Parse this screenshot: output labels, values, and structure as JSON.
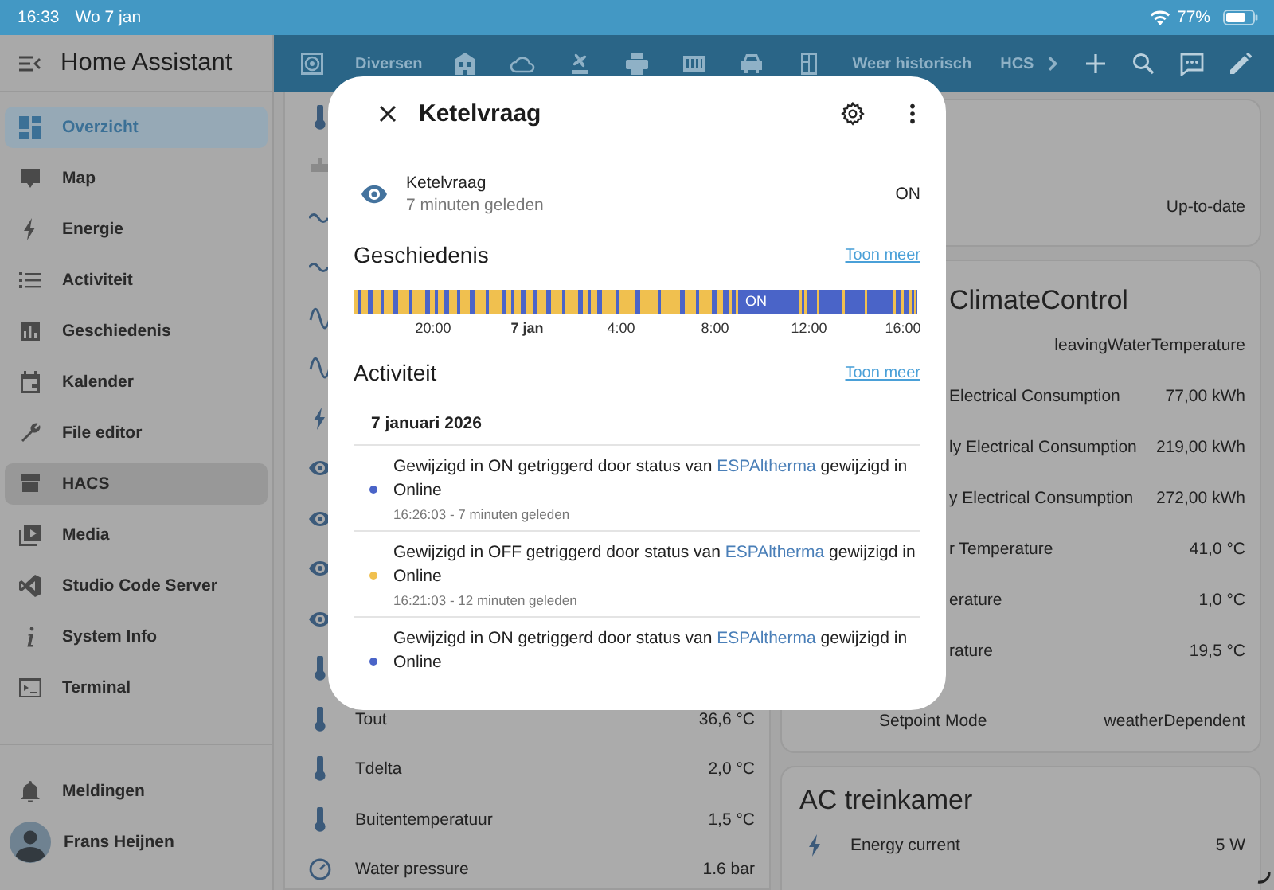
{
  "status_bar": {
    "time": "16:33",
    "date": "Wo 7 jan",
    "battery": "77%"
  },
  "sidebar": {
    "title": "Home Assistant",
    "items": [
      {
        "label": "Overzicht",
        "selected": true,
        "hovered": false
      },
      {
        "label": "Map",
        "selected": false,
        "hovered": false
      },
      {
        "label": "Energie",
        "selected": false,
        "hovered": false
      },
      {
        "label": "Activiteit",
        "selected": false,
        "hovered": false
      },
      {
        "label": "Geschiedenis",
        "selected": false,
        "hovered": false
      },
      {
        "label": "Kalender",
        "selected": false,
        "hovered": false
      },
      {
        "label": "File editor",
        "selected": false,
        "hovered": false
      },
      {
        "label": "HACS",
        "selected": false,
        "hovered": true
      },
      {
        "label": "Media",
        "selected": false,
        "hovered": false
      },
      {
        "label": "Studio Code Server",
        "selected": false,
        "hovered": false
      },
      {
        "label": "System Info",
        "selected": false,
        "hovered": false
      },
      {
        "label": "Terminal",
        "selected": false,
        "hovered": false
      }
    ],
    "notifications": "Meldingen",
    "user": "Frans Heijnen"
  },
  "toolbar": {
    "tabs": [
      {
        "kind": "icon"
      },
      {
        "kind": "text",
        "label": "Diversen"
      },
      {
        "kind": "icon"
      },
      {
        "kind": "icon"
      },
      {
        "kind": "icon"
      },
      {
        "kind": "icon"
      },
      {
        "kind": "icon"
      },
      {
        "kind": "icon"
      },
      {
        "kind": "icon"
      },
      {
        "kind": "text",
        "label": "Weer historisch"
      },
      {
        "kind": "text",
        "label": "HCS"
      }
    ]
  },
  "left_card": {
    "rows": [
      {
        "kind": "thermometer"
      },
      {
        "kind": "meter"
      },
      {
        "kind": "wave"
      },
      {
        "kind": "wave"
      },
      {
        "kind": "sine"
      },
      {
        "kind": "sine"
      },
      {
        "kind": "bolt"
      },
      {
        "kind": "eye"
      },
      {
        "kind": "eye"
      },
      {
        "kind": "eye"
      },
      {
        "kind": "eye"
      },
      {
        "kind": "thermometer"
      },
      {
        "kind": "thermometer",
        "name": "Tout",
        "value": "36,6 °C"
      },
      {
        "kind": "thermometer",
        "name": "Tdelta",
        "value": "2,0 °C"
      },
      {
        "kind": "thermometer",
        "name": "Buitentemperatuur",
        "value": "1,5 °C"
      },
      {
        "kind": "gauge",
        "name": "Water pressure",
        "value": "1.6 bar"
      }
    ]
  },
  "right_cards": [
    {
      "rows": [
        {
          "kind": "cut",
          "value": "Up-to-date"
        }
      ]
    },
    {
      "title": "ClimateControl",
      "rows": [
        {
          "kind": "cut",
          "value": "leavingWaterTemperature"
        },
        {
          "kind": "cut",
          "name": "Electrical Consumption",
          "value": "77,00 kWh"
        },
        {
          "kind": "cut",
          "name": "ly Electrical Consumption",
          "value": "219,00 kWh"
        },
        {
          "kind": "cut",
          "name": "y Electrical Consumption",
          "value": "272,00 kWh"
        },
        {
          "kind": "cut",
          "name": "r Temperature",
          "value": "41,0 °C"
        },
        {
          "kind": "cut",
          "name": "erature",
          "value": "1,0 °C"
        },
        {
          "kind": "cut",
          "name": "rature",
          "value": "19,5 °C"
        },
        {
          "kind": "full",
          "name": "Setpoint Mode",
          "value": "weatherDependent"
        }
      ]
    },
    {
      "title": "AC treinkamer",
      "rows": [
        {
          "kind": "full",
          "name": "Energy current",
          "value": "5 W"
        }
      ]
    }
  ],
  "dialog": {
    "title": "Ketelvraag",
    "entity": {
      "name": "Ketelvraag",
      "changed": "7 minuten geleden",
      "state": "ON"
    },
    "history": {
      "heading": "Geschiedenis",
      "more": "Toon meer",
      "bar_label": "ON",
      "ticks": [
        "20:00",
        "7 jan",
        "4:00",
        "8:00",
        "12:00",
        "16:00"
      ]
    },
    "activity": {
      "heading": "Activiteit",
      "more": "Toon meer",
      "date": "7 januari 2026",
      "entries": [
        {
          "before": "Gewijzigd in ON getriggerd door status van ",
          "link": "ESPAltherma",
          "after": " gewijzigd in",
          "line2": "Online",
          "time": "16:26:03 - 7 minuten geleden",
          "color": "#4a64c8"
        },
        {
          "before": "Gewijzigd in OFF getriggerd door status van ",
          "link": "ESPAltherma",
          "after": " gewijzigd in",
          "line2": "Online",
          "time": "16:21:03 - 12 minuten geleden",
          "color": "#f0c04f"
        },
        {
          "before": "Gewijzigd in ON getriggerd door status van ",
          "link": "ESPAltherma",
          "after": " gewijzigd in",
          "line2": "Online",
          "color": "#4a64c8"
        }
      ]
    }
  }
}
